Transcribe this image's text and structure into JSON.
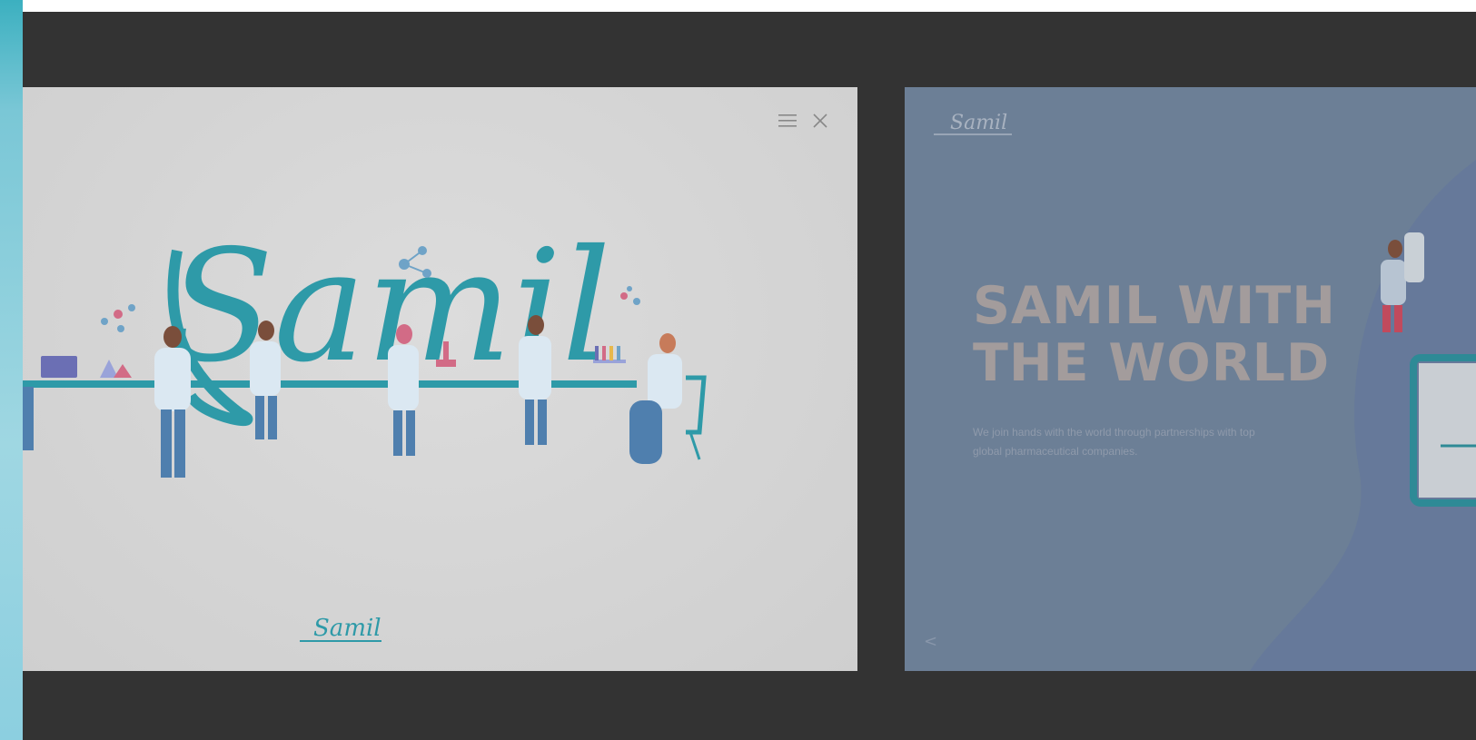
{
  "menu": {
    "menu_icon": "hamburger-menu-icon",
    "close_icon": "close-icon"
  },
  "slide1": {
    "hero_wordmark": "Samil",
    "footer_logo": "Samil"
  },
  "slide2": {
    "logo": "Samil",
    "heading_line1": "SAMIL WITH",
    "heading_line2": "THE WORLD",
    "description": "We join hands with the world through partnerships with top global pharmaceutical companies.",
    "prev_arrow": "<"
  },
  "colors": {
    "teal": "#2e9aa8",
    "stage_bg": "#333333",
    "slide1_bg": "#d6d6d6",
    "slide2_bg": "#6c7f96",
    "heading": "#a39c9c"
  }
}
